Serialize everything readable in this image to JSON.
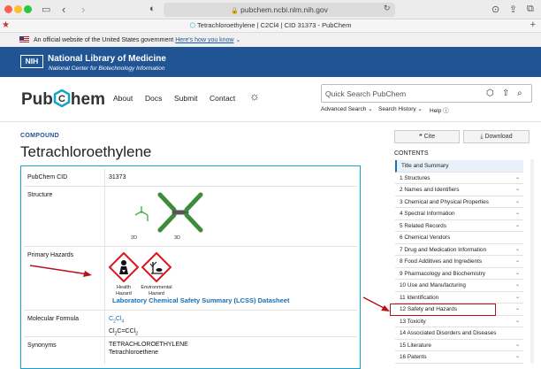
{
  "browser": {
    "url": "pubchem.ncbi.nlm.nih.gov",
    "tab_title": "Tetrachloroethylene | C2Cl4 | CID 31373 - PubChem"
  },
  "gov_banner": {
    "text": "An official website of the United States government",
    "link": "Here's how you know"
  },
  "nlm": {
    "logo": "NIH",
    "title": "National Library of Medicine",
    "subtitle": "National Center for Biotechnology Information"
  },
  "header": {
    "logo_left": "Pub",
    "logo_right": "hem",
    "nav": [
      "About",
      "Docs",
      "Submit",
      "Contact"
    ],
    "search_placeholder": "Quick Search PubChem",
    "search_links": [
      "Advanced Search",
      "Search History",
      "Help"
    ]
  },
  "compound": {
    "kicker": "COMPOUND",
    "name": "Tetrachloroethylene"
  },
  "summary": {
    "rows": [
      {
        "label": "PubChem CID",
        "value": "31373"
      },
      {
        "label": "Structure",
        "value": ""
      },
      {
        "label": "Primary Hazards",
        "value": ""
      },
      {
        "label": "Molecular Formula",
        "value": ""
      },
      {
        "label": "Synonyms",
        "value": ""
      }
    ],
    "structure_2d": "2D",
    "structure_3d": "3D",
    "hazards": [
      {
        "line1": "Health",
        "line2": "Hazard",
        "icon": "health-hazard-icon"
      },
      {
        "line1": "Environmental",
        "line2": "Hazard",
        "icon": "environmental-hazard-icon"
      }
    ],
    "lcss_link": "Laboratory Chemical Safety Summary (LCSS) Datasheet",
    "formula_main": "C",
    "formula_sub1": "2",
    "formula_cl": "Cl",
    "formula_sub2": "4",
    "formula_alt": "Cl",
    "formula_alt_sub": "2",
    "formula_alt_mid": "C=CCl",
    "formula_alt_sub2": "2",
    "synonyms": [
      "TETRACHLOROETHYLENE",
      "Tetrachloroethene"
    ]
  },
  "sidebar": {
    "cite": "Cite",
    "download": "Download",
    "contents_heading": "CONTENTS",
    "items": [
      "Title and Summary",
      "1 Structures",
      "2 Names and Identifiers",
      "3 Chemical and Physical Properties",
      "4 Spectral Information",
      "5 Related Records",
      "6 Chemical Vendors",
      "7 Drug and Medication Information",
      "8 Food Additives and Ingredients",
      "9 Pharmacology and Biochemistry",
      "10 Use and Manufacturing",
      "11 Identification",
      "12 Safety and Hazards",
      "13 Toxicity",
      "14 Associated Disorders and Diseases",
      "15 Literature",
      "16 Patents"
    ]
  },
  "colors": {
    "nlm_blue": "#205493",
    "pubchem_teal": "#12a5c6",
    "highlight_red": "#b3131b",
    "box_border": "#1aa0d0"
  }
}
